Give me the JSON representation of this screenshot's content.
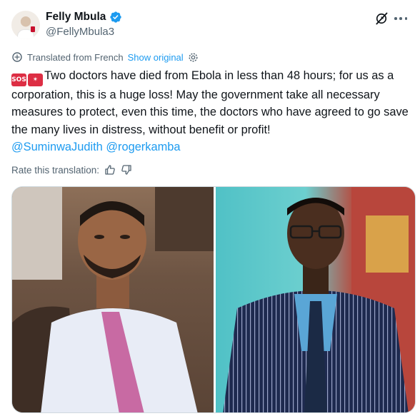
{
  "author": {
    "display_name": "Felly Mbula",
    "handle": "@FellyMbula3",
    "verified": true,
    "avatar_icon": "avatar-photo"
  },
  "header_actions": {
    "grok_icon": "grok-icon",
    "more_icon": "more-icon"
  },
  "translation": {
    "label": "Translated from French",
    "show_original": "Show original",
    "settings_icon": "gear-icon"
  },
  "tweet": {
    "emoji_1": "SOS",
    "emoji_2": "✴",
    "text": "Two doctors have died from Ebola in less than 48 hours; for us as a corporation, this is a huge loss! May the government take all necessary measures to protect, even this time, the doctors who have agreed to go save the many lives in distress, without benefit or profit!",
    "mentions": [
      "@SuminwaJudith",
      "@rogerkamba"
    ]
  },
  "rate": {
    "label": "Rate this translation:",
    "up_icon": "thumbs-up-icon",
    "down_icon": "thumbs-down-icon"
  },
  "media": {
    "photos": [
      "photo-man-pink-tie",
      "photo-man-pinstripe-suit"
    ]
  },
  "colors": {
    "accent": "#1d9bf0",
    "text": "#0f1419",
    "muted": "#536471",
    "sos_red": "#dd2e44"
  }
}
